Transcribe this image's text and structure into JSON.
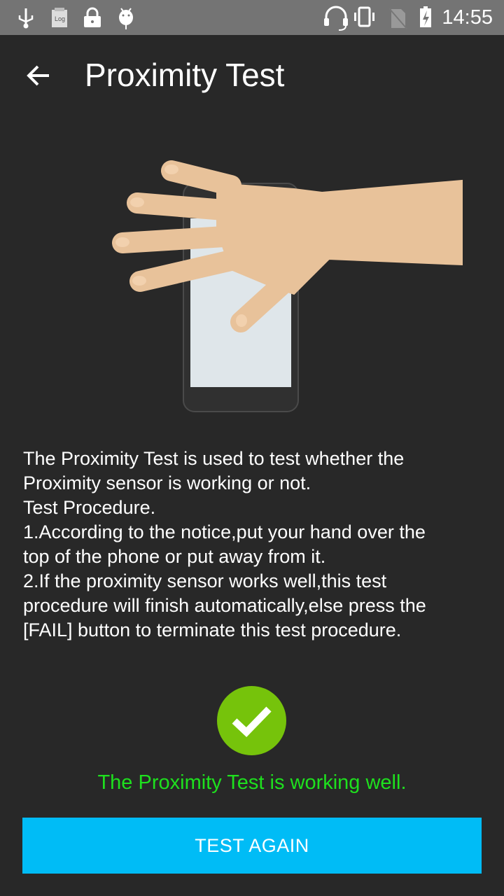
{
  "status_bar": {
    "time": "14:55",
    "left_icons": [
      "usb-icon",
      "log-icon",
      "lock-icon",
      "android-debug-icon"
    ],
    "right_icons": [
      "headset-icon",
      "vibrate-icon",
      "no-sim-icon",
      "battery-charging-icon"
    ]
  },
  "app_bar": {
    "title": "Proximity Test",
    "back_icon": "arrow-back-icon"
  },
  "description": {
    "lines": [
      "The Proximity Test is used to test whether the",
      "Proximity sensor is working or not.",
      "Test Procedure.",
      "1.According to the notice,put your hand over the",
      "top of the phone or put away from it.",
      "2.If the proximity sensor works well,this test",
      "procedure will finish automatically,else press the",
      "[FAIL] button to terminate this test procedure."
    ]
  },
  "result": {
    "icon": "check-circle-icon",
    "message": "The Proximity Test is working well.",
    "color": "#1ee01e"
  },
  "button": {
    "label": "TEST AGAIN",
    "color": "#00bcf6"
  }
}
